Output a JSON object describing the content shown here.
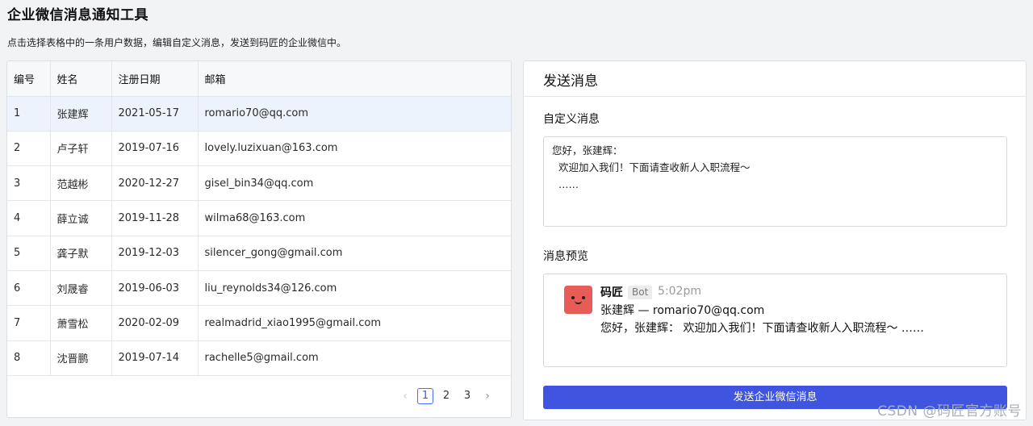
{
  "page": {
    "title": "企业微信消息通知工具",
    "subtitle": "点击选择表格中的一条用户数据，编辑自定义消息，发送到码匠的企业微信中。"
  },
  "table": {
    "headers": [
      "编号",
      "姓名",
      "注册日期",
      "邮箱"
    ],
    "rows": [
      [
        "1",
        "张建辉",
        "2021-05-17",
        "romario70@qq.com"
      ],
      [
        "2",
        "卢子轩",
        "2019-07-16",
        "lovely.luzixuan@163.com"
      ],
      [
        "3",
        "范越彬",
        "2020-12-27",
        "gisel_bin34@qq.com"
      ],
      [
        "4",
        "薛立诚",
        "2019-11-28",
        "wilma68@163.com"
      ],
      [
        "5",
        "龚子默",
        "2019-12-03",
        "silencer_gong@gmail.com"
      ],
      [
        "6",
        "刘晟睿",
        "2019-06-03",
        "liu_reynolds34@126.com"
      ],
      [
        "7",
        "萧雪松",
        "2020-02-09",
        "realmadrid_xiao1995@gmail.com"
      ],
      [
        "8",
        "沈晋鹏",
        "2019-07-14",
        "rachelle5@gmail.com"
      ]
    ],
    "selected_row": 0
  },
  "pagination": {
    "prev": "‹",
    "pages": [
      "1",
      "2",
      "3"
    ],
    "next": "›",
    "current": "1"
  },
  "send_panel": {
    "header": "发送消息",
    "custom_label": "自定义消息",
    "message_value": "您好，张建辉：\n  欢迎加入我们！下面请查收新人入职流程～\n  ……",
    "preview_label": "消息预览",
    "preview": {
      "bot_name": "码匠",
      "bot_badge": "Bot",
      "time": "5:02pm",
      "line1": "张建辉 — romario70@qq.com",
      "line2": "您好，张建辉：  欢迎加入我们！下面请查收新人入职流程～ ……"
    },
    "send_button": "发送企业微信消息"
  },
  "watermark": "CSDN @码匠官方账号",
  "colors": {
    "accent": "#3f55e0",
    "selected_row_bg": "#edf3fc",
    "avatar": "#e85c57"
  }
}
